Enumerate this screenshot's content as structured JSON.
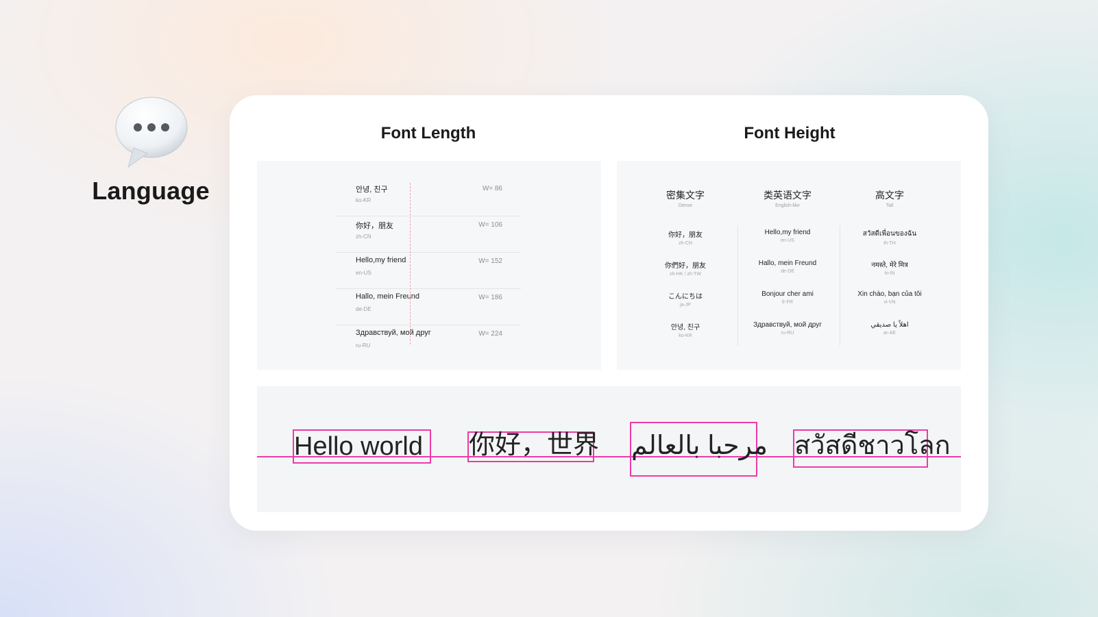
{
  "side": {
    "title": "Language",
    "icon": "speech-bubble-icon"
  },
  "sections": {
    "length_title": "Font Length",
    "height_title": "Font Height"
  },
  "font_length": {
    "rows": [
      {
        "text": "안녕, 친구",
        "code": "ko-KR",
        "width": "W= 86"
      },
      {
        "text": "你好，朋友",
        "code": "zh-CN",
        "width": "W= 106"
      },
      {
        "text": "Hello,my friend",
        "code": "en-US",
        "width": "W= 152"
      },
      {
        "text": "Hallo, mein Freund",
        "code": "de-DE",
        "width": "W= 186"
      },
      {
        "text": "Здравствуй, мой друг",
        "code": "ru-RU",
        "width": "W= 224"
      }
    ]
  },
  "font_height": {
    "columns": [
      {
        "title": "密集文字",
        "subtitle": "Dense",
        "items": [
          {
            "text": "你好，朋友",
            "code": "zh-CN"
          },
          {
            "text": "你們好，朋友",
            "code": "zh-HK / zh-TW"
          },
          {
            "text": "こんにちは",
            "code": "ja-JP"
          },
          {
            "text": "안녕, 친구",
            "code": "ko-KR"
          }
        ]
      },
      {
        "title": "类英语文字",
        "subtitle": "English-like",
        "items": [
          {
            "text": "Hello,my friend",
            "code": "en-US"
          },
          {
            "text": "Hallo, mein Freund",
            "code": "de-DE"
          },
          {
            "text": "Bonjour cher ami",
            "code": "fr-FR"
          },
          {
            "text": "Здравствуй, мой друг",
            "code": "ru-RU"
          }
        ]
      },
      {
        "title": "高文字",
        "subtitle": "Tall",
        "items": [
          {
            "text": "สวัสดีเพื่อนของฉัน",
            "code": "th-TH"
          },
          {
            "text": "नमस्ते, मेरे मित्र",
            "code": "hi-IN"
          },
          {
            "text": "Xin chào, bạn của tôi",
            "code": "vi-VN"
          },
          {
            "text": "اهلاً يا صديقي",
            "code": "ar-AE"
          }
        ]
      }
    ]
  },
  "demo": {
    "samples": [
      "Hello world",
      "你好，世界",
      "مرحبا بالعالم",
      "สวัสดีชาวโลก"
    ],
    "guide_color": "#ec3aa8"
  }
}
